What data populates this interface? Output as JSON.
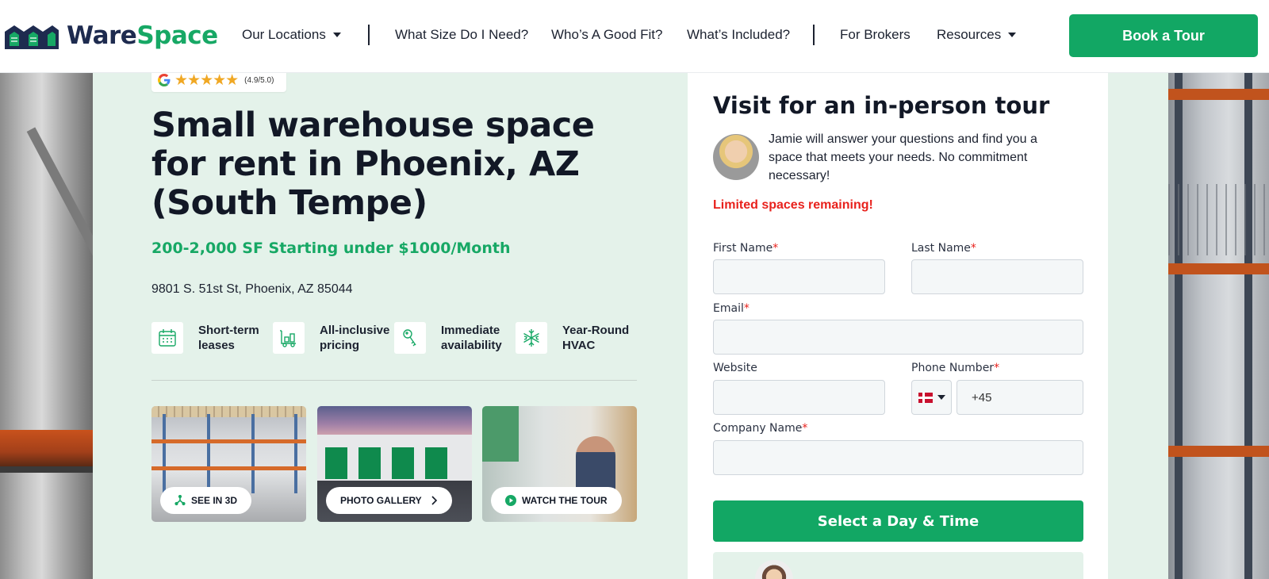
{
  "header": {
    "logo": {
      "ware": "Ware",
      "space": "Space"
    },
    "nav": [
      {
        "label": "Our Locations",
        "dropdown": true
      },
      {
        "label": "What Size Do I Need?",
        "dropdown": false
      },
      {
        "label": "Who’s A Good Fit?",
        "dropdown": false
      },
      {
        "label": "What’s Included?",
        "dropdown": false
      },
      {
        "label": "For Brokers",
        "dropdown": false
      },
      {
        "label": "Resources",
        "dropdown": true
      }
    ],
    "cta_label": "Book a Tour"
  },
  "hero": {
    "rating_stars": 4.9,
    "rating_text": "(4.9/5.0)",
    "headline": "Small warehouse space for rent in Phoenix, AZ (South Tempe)",
    "subheadline": "200-2,000 SF Starting under $1000/Month",
    "address": "9801 S. 51st St, Phoenix, AZ 85044",
    "features": [
      {
        "icon": "calendar-icon",
        "label": "Short-term leases"
      },
      {
        "icon": "pricing-icon",
        "label": "All-inclusive pricing"
      },
      {
        "icon": "key-icon",
        "label": "Immediate availability"
      },
      {
        "icon": "snowflake-icon",
        "label": "Year-Round HVAC"
      }
    ],
    "media": [
      {
        "label": "SEE IN 3D",
        "icon": "3d-icon"
      },
      {
        "label": "PHOTO GALLERY",
        "icon": "chevron-right-icon"
      },
      {
        "label": "WATCH THE TOUR",
        "icon": "play-icon"
      }
    ]
  },
  "form": {
    "title": "Visit for an in-person tour",
    "intro": "Jamie will answer your questions and find you a space that meets your needs. No commitment necessary!",
    "limited": "Limited spaces remaining!",
    "required_mark": "*",
    "fields": {
      "first_name": {
        "label": "First Name",
        "value": ""
      },
      "last_name": {
        "label": "Last Name",
        "value": ""
      },
      "email": {
        "label": "Email",
        "value": ""
      },
      "website": {
        "label": "Website",
        "value": ""
      },
      "phone": {
        "label": "Phone Number",
        "value": "+45",
        "country_flag": "Denmark"
      },
      "company": {
        "label": "Company Name",
        "value": ""
      }
    },
    "submit_label": "Select a Day & Time"
  },
  "colors": {
    "brand_green": "#12a764",
    "brand_navy": "#1e2b4f",
    "panel_green": "#e4f2ea",
    "alert_red": "#e8211c",
    "star_gold": "#f0a824"
  }
}
